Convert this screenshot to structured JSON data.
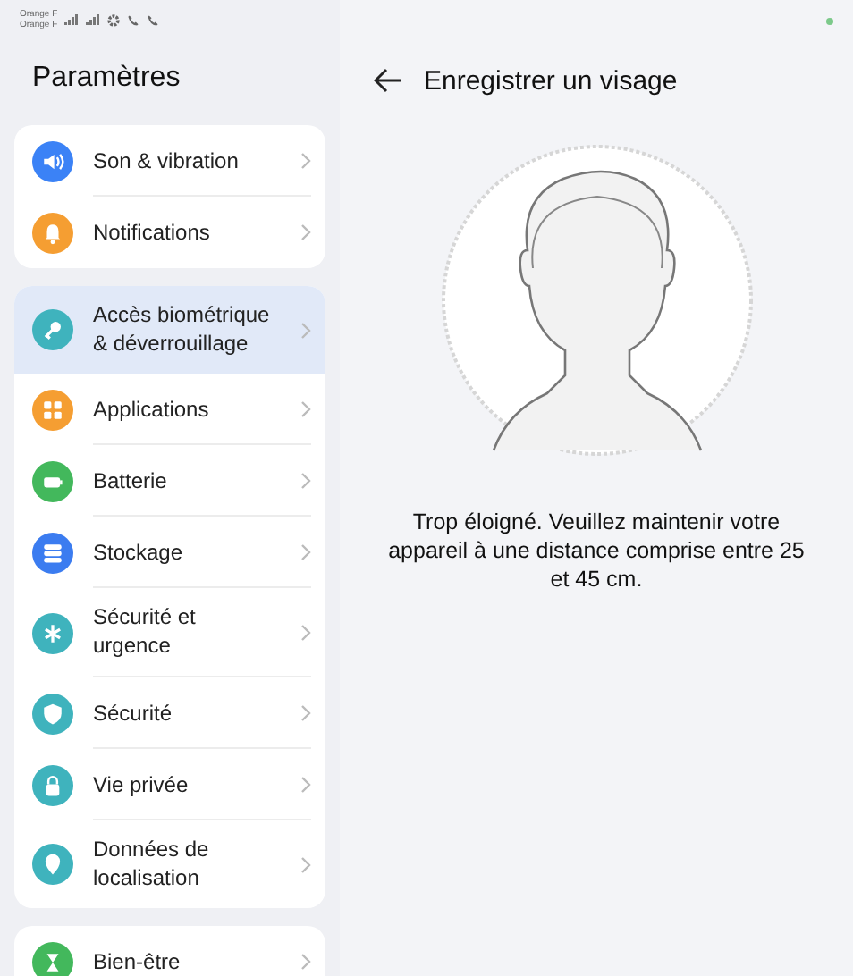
{
  "status_bar": {
    "carriers": [
      "Orange F",
      "Orange F"
    ]
  },
  "sidebar": {
    "title": "Paramètres",
    "groups": [
      {
        "items": [
          {
            "label": "Son & vibration",
            "kind": "sound",
            "color": "#3b82f6",
            "selected": false
          },
          {
            "label": "Notifications",
            "kind": "bell",
            "color": "#f59e32",
            "selected": false
          }
        ]
      },
      {
        "items": [
          {
            "label": "Accès biométrique & déverrouillage",
            "kind": "key",
            "color": "#3fb3bd",
            "selected": true
          },
          {
            "label": "Applications",
            "kind": "apps",
            "color": "#f59e32",
            "selected": false
          },
          {
            "label": "Batterie",
            "kind": "battery",
            "color": "#43b85c",
            "selected": false
          },
          {
            "label": "Stockage",
            "kind": "storage",
            "color": "#3b7cf0",
            "selected": false
          },
          {
            "label": "Sécurité et urgence",
            "kind": "asterisk",
            "color": "#3fb3bd",
            "selected": false
          },
          {
            "label": "Sécurité",
            "kind": "shield",
            "color": "#3fb3bd",
            "selected": false
          },
          {
            "label": "Vie privée",
            "kind": "lock",
            "color": "#3fb3bd",
            "selected": false
          },
          {
            "label": "Données de localisation",
            "kind": "pin",
            "color": "#3fb3bd",
            "selected": false
          }
        ]
      },
      {
        "items": [
          {
            "label": "Bien-être",
            "kind": "wellbeing",
            "color": "#43b85c",
            "selected": false
          }
        ]
      }
    ]
  },
  "page": {
    "title": "Enregistrer un visage",
    "message": "Trop éloigné. Veuillez maintenir votre appareil à une distance comprise entre 25 et 45 cm."
  }
}
